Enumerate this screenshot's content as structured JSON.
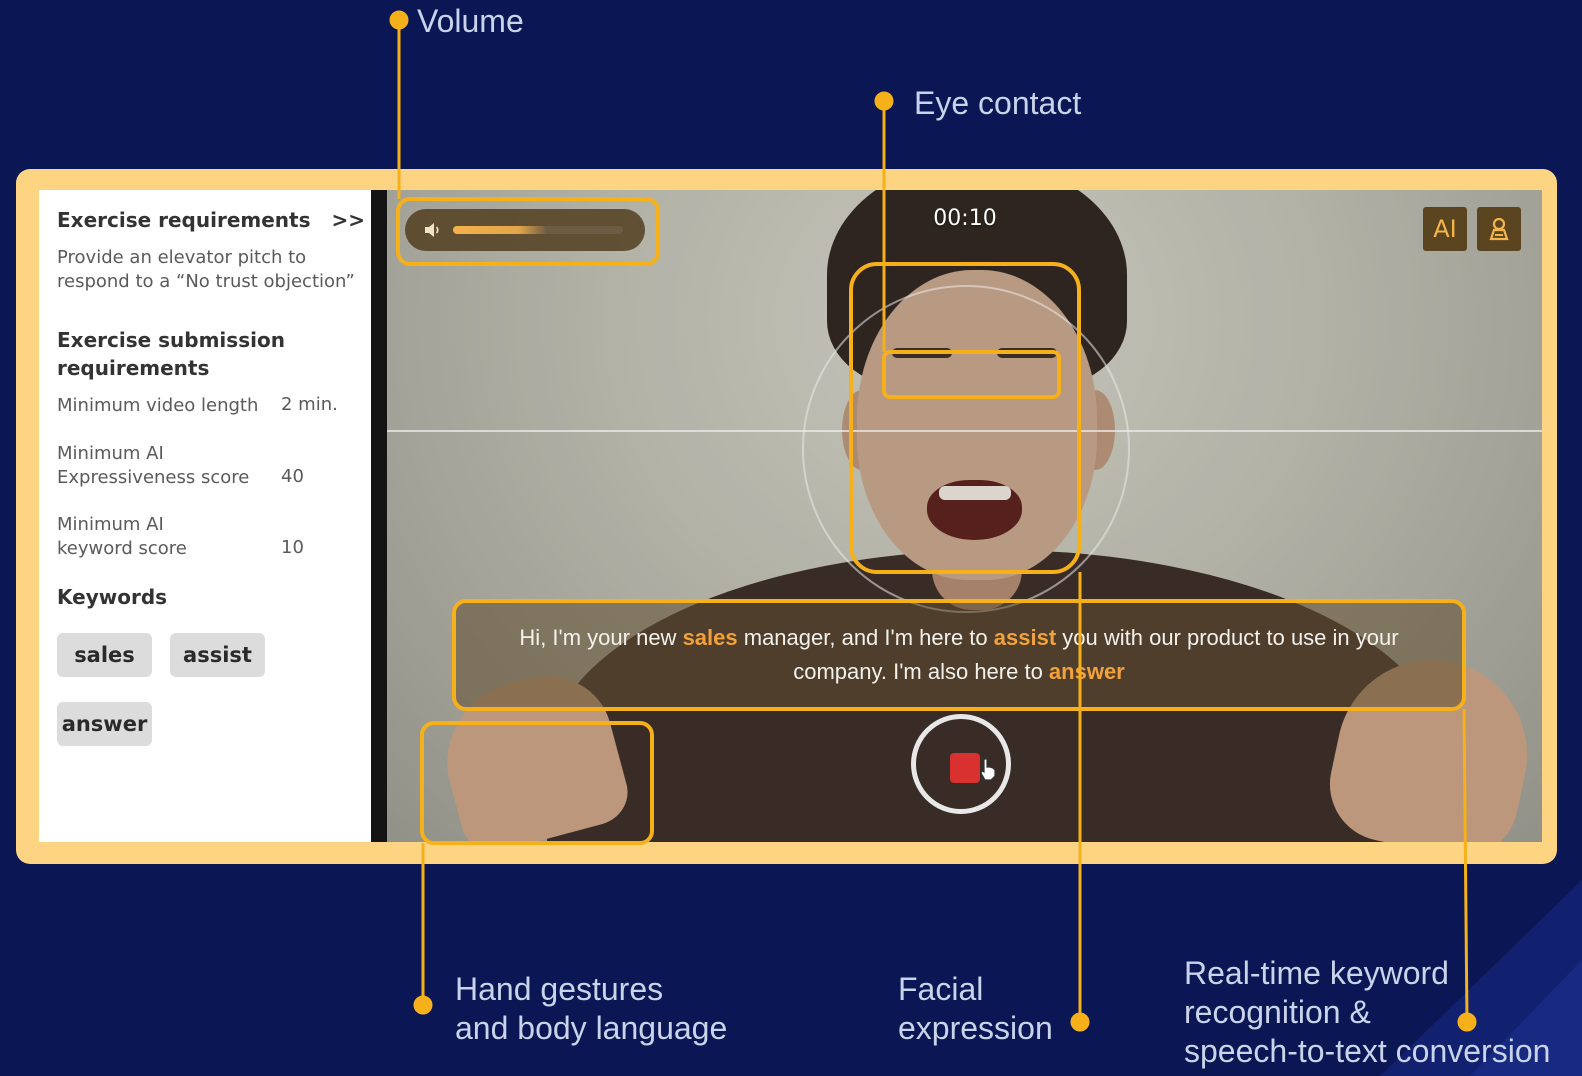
{
  "callouts": {
    "volume": "Volume",
    "eye_contact": "Eye contact",
    "hand_gestures": "Hand gestures\nand body language",
    "facial_expression": "Facial\nexpression",
    "keyword_recognition": "Real-time keyword\nrecognition &\nspeech-to-text conversion"
  },
  "sidebar": {
    "exercise_requirements": {
      "title": "Exercise requirements",
      "expand_label": ">>",
      "description": "Provide an elevator pitch to respond to a “No trust objection”"
    },
    "submission": {
      "title": "Exercise submission requirements",
      "rows": [
        {
          "label": "Minimum video length",
          "value": "2 min."
        },
        {
          "label": "Minimum AI\nExpressiveness score",
          "value": "40"
        },
        {
          "label": "Minimum AI\nkeyword score",
          "value": "10"
        }
      ]
    },
    "keywords": {
      "title": "Keywords",
      "chips": [
        "sales",
        "assist",
        "answer"
      ]
    }
  },
  "video": {
    "timer": "00:10",
    "volume_level": 0.55,
    "ai_button": "AI",
    "profile_icon": "person-outline-icon",
    "caption": {
      "part1": "Hi, I'm your new ",
      "kw1": "sales",
      "part2": " manager, and I'm here to ",
      "kw2": "assist",
      "part3": " you with our product to use in your company. I'm also here to ",
      "kw3": "answer"
    },
    "record_button": "stop-record-icon"
  },
  "colors": {
    "background": "#0b1655",
    "frame": "#fcd482",
    "highlight": "#f6b01a",
    "keyword": "#f3a13a"
  }
}
